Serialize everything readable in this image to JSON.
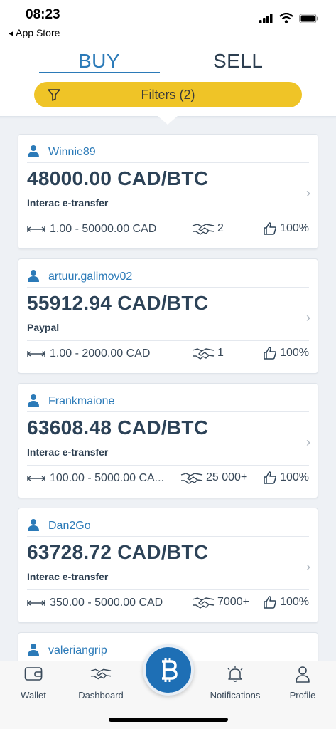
{
  "status": {
    "time": "08:23",
    "back_label": "◂ App Store"
  },
  "tabs": {
    "buy": "BUY",
    "sell": "SELL"
  },
  "filters": {
    "label": "Filters (2)"
  },
  "offers": [
    {
      "user": "Winnie89",
      "price": "48000.00 CAD/BTC",
      "method": "Interac e-transfer",
      "limits": "1.00 - 50000.00 CAD",
      "trades": "2",
      "rating": "100%"
    },
    {
      "user": "artuur.galimov02",
      "price": "55912.94 CAD/BTC",
      "method": "Paypal",
      "limits": "1.00 - 2000.00 CAD",
      "trades": "1",
      "rating": "100%"
    },
    {
      "user": "Frankmaione",
      "price": "63608.48 CAD/BTC",
      "method": "Interac e-transfer",
      "limits": "100.00 - 5000.00 CA...",
      "trades": "25 000+",
      "rating": "100%"
    },
    {
      "user": "Dan2Go",
      "price": "63728.72 CAD/BTC",
      "method": "Interac e-transfer",
      "limits": "350.00 - 5000.00 CAD",
      "trades": "7000+",
      "rating": "100%"
    },
    {
      "user": "valeriangrip"
    }
  ],
  "nav": {
    "wallet": "Wallet",
    "dashboard": "Dashboard",
    "notifications": "Notifications",
    "profile": "Profile"
  },
  "colors": {
    "accent": "#2b7ab8",
    "filter_bg": "#efc427",
    "center_button": "#1e6fb5"
  }
}
